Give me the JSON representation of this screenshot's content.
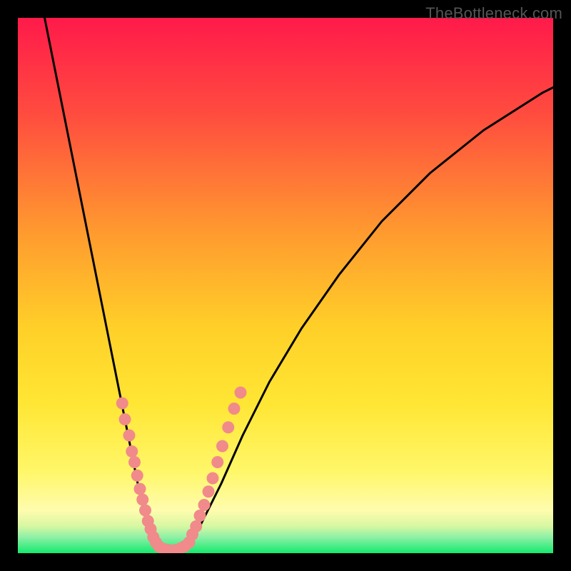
{
  "watermark": "TheBottleneck.com",
  "colors": {
    "frame": "#000000",
    "curve": "#000000",
    "dots": "#f18a8a",
    "greenBand": "#13ea6e"
  },
  "chart_data": {
    "type": "line",
    "title": "",
    "xlabel": "",
    "ylabel": "",
    "xlim": [
      0,
      100
    ],
    "ylim": [
      0,
      100
    ],
    "gradient_bands": [
      {
        "y0": 100,
        "y1": 30,
        "color_top": "#ff1a4a",
        "color_bottom": "#ffe634"
      },
      {
        "y0": 30,
        "y1": 10,
        "color_top": "#ffe634",
        "color_bottom": "#fffb9a"
      },
      {
        "y0": 10,
        "y1": 3,
        "color_top": "#fffb9a",
        "color_bottom": "#8ff0a6"
      },
      {
        "y0": 3,
        "y1": 0,
        "color_top": "#8ff0a6",
        "color_bottom": "#13ea6e"
      }
    ],
    "series": [
      {
        "name": "left-branch",
        "x": [
          5,
          7,
          9,
          11,
          13,
          15,
          17,
          19,
          21,
          22,
          23,
          24,
          25,
          25.8
        ],
        "y": [
          100,
          90,
          80,
          70,
          60,
          50,
          40,
          30,
          20,
          15,
          10,
          6,
          3,
          1.2
        ]
      },
      {
        "name": "valley-floor",
        "x": [
          25.8,
          27,
          28.5,
          30,
          31.5
        ],
        "y": [
          1.2,
          0.5,
          0.3,
          0.5,
          1.2
        ]
      },
      {
        "name": "right-branch",
        "x": [
          31.5,
          33,
          35,
          38,
          42,
          47,
          53,
          60,
          68,
          77,
          87,
          98,
          100
        ],
        "y": [
          1.2,
          3,
          7,
          13,
          22,
          32,
          42,
          52,
          62,
          71,
          79,
          86,
          87
        ]
      }
    ],
    "dot_clusters": [
      {
        "name": "left-cluster",
        "points": [
          {
            "x": 19.5,
            "y": 28
          },
          {
            "x": 20.0,
            "y": 25
          },
          {
            "x": 20.8,
            "y": 22
          },
          {
            "x": 21.3,
            "y": 19
          },
          {
            "x": 21.8,
            "y": 17
          },
          {
            "x": 22.3,
            "y": 14.5
          },
          {
            "x": 22.8,
            "y": 12
          },
          {
            "x": 23.3,
            "y": 10
          },
          {
            "x": 23.8,
            "y": 8
          },
          {
            "x": 24.3,
            "y": 6
          },
          {
            "x": 24.8,
            "y": 4.5
          },
          {
            "x": 25.3,
            "y": 3
          },
          {
            "x": 25.8,
            "y": 2
          }
        ]
      },
      {
        "name": "bottom-cluster",
        "points": [
          {
            "x": 26.4,
            "y": 1.2
          },
          {
            "x": 27.2,
            "y": 0.8
          },
          {
            "x": 28.0,
            "y": 0.6
          },
          {
            "x": 28.8,
            "y": 0.5
          },
          {
            "x": 29.6,
            "y": 0.6
          },
          {
            "x": 30.4,
            "y": 0.9
          },
          {
            "x": 31.2,
            "y": 1.3
          }
        ]
      },
      {
        "name": "right-cluster",
        "points": [
          {
            "x": 32.0,
            "y": 2
          },
          {
            "x": 32.6,
            "y": 3.5
          },
          {
            "x": 33.3,
            "y": 5
          },
          {
            "x": 34.0,
            "y": 7
          },
          {
            "x": 34.8,
            "y": 9
          },
          {
            "x": 35.6,
            "y": 11.5
          },
          {
            "x": 36.4,
            "y": 14
          },
          {
            "x": 37.3,
            "y": 17
          },
          {
            "x": 38.2,
            "y": 20
          },
          {
            "x": 39.3,
            "y": 23.5
          },
          {
            "x": 40.4,
            "y": 27
          },
          {
            "x": 41.6,
            "y": 30
          }
        ]
      }
    ]
  }
}
